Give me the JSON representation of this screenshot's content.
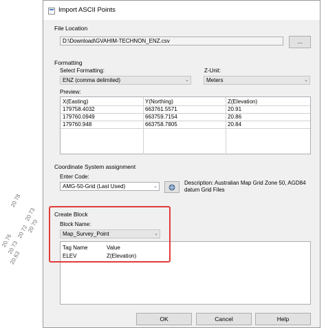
{
  "background_labels": [
    "20 78",
    "20 73",
    "20 70",
    "20 72",
    "20.76",
    "20 73",
    "20.63"
  ],
  "window": {
    "title": "Import ASCII Points"
  },
  "file_location": {
    "group_title": "File Location",
    "path": "D:\\Download\\GVAHIM-TECHNON_ENZ.csv",
    "browse_label": "..."
  },
  "formatting": {
    "group_title": "Formatting",
    "select_label": "Select Formatting:",
    "select_value": "ENZ (comma delimited)",
    "z_unit_label": "Z-Unit:",
    "z_unit_value": "Meters",
    "preview_label": "Preview:",
    "preview_columns": [
      "X(Easting)",
      "Y(Northing)",
      "Z(Elevation)"
    ],
    "preview_rows": [
      [
        "179758.4032",
        "663761.5571",
        "20.91"
      ],
      [
        "179760.0949",
        "663759.7154",
        "20.86"
      ],
      [
        "179760.948",
        "663758.7805",
        "20.84"
      ]
    ]
  },
  "coordinate_system": {
    "group_title": "Coordinate System assignment",
    "enter_code_label": "Enter Code:",
    "code_value": "AMG-50-Grid (Last Used)",
    "description": "Description: Australian Map Grid Zone 50, AGD84 datum Grid Files"
  },
  "create_block": {
    "group_title": "Create Block",
    "block_name_label": "Block Name:",
    "block_name_value": "Map_Survey_Point",
    "columns": [
      "Tag Name",
      "Value"
    ],
    "rows": [
      [
        "ELEV",
        "Z(Elevation)"
      ]
    ]
  },
  "buttons": {
    "ok": "OK",
    "cancel": "Cancel",
    "help": "Help"
  },
  "colors": {
    "highlight": "#e23a3a",
    "dialog_bg": "#f0f0f0"
  }
}
